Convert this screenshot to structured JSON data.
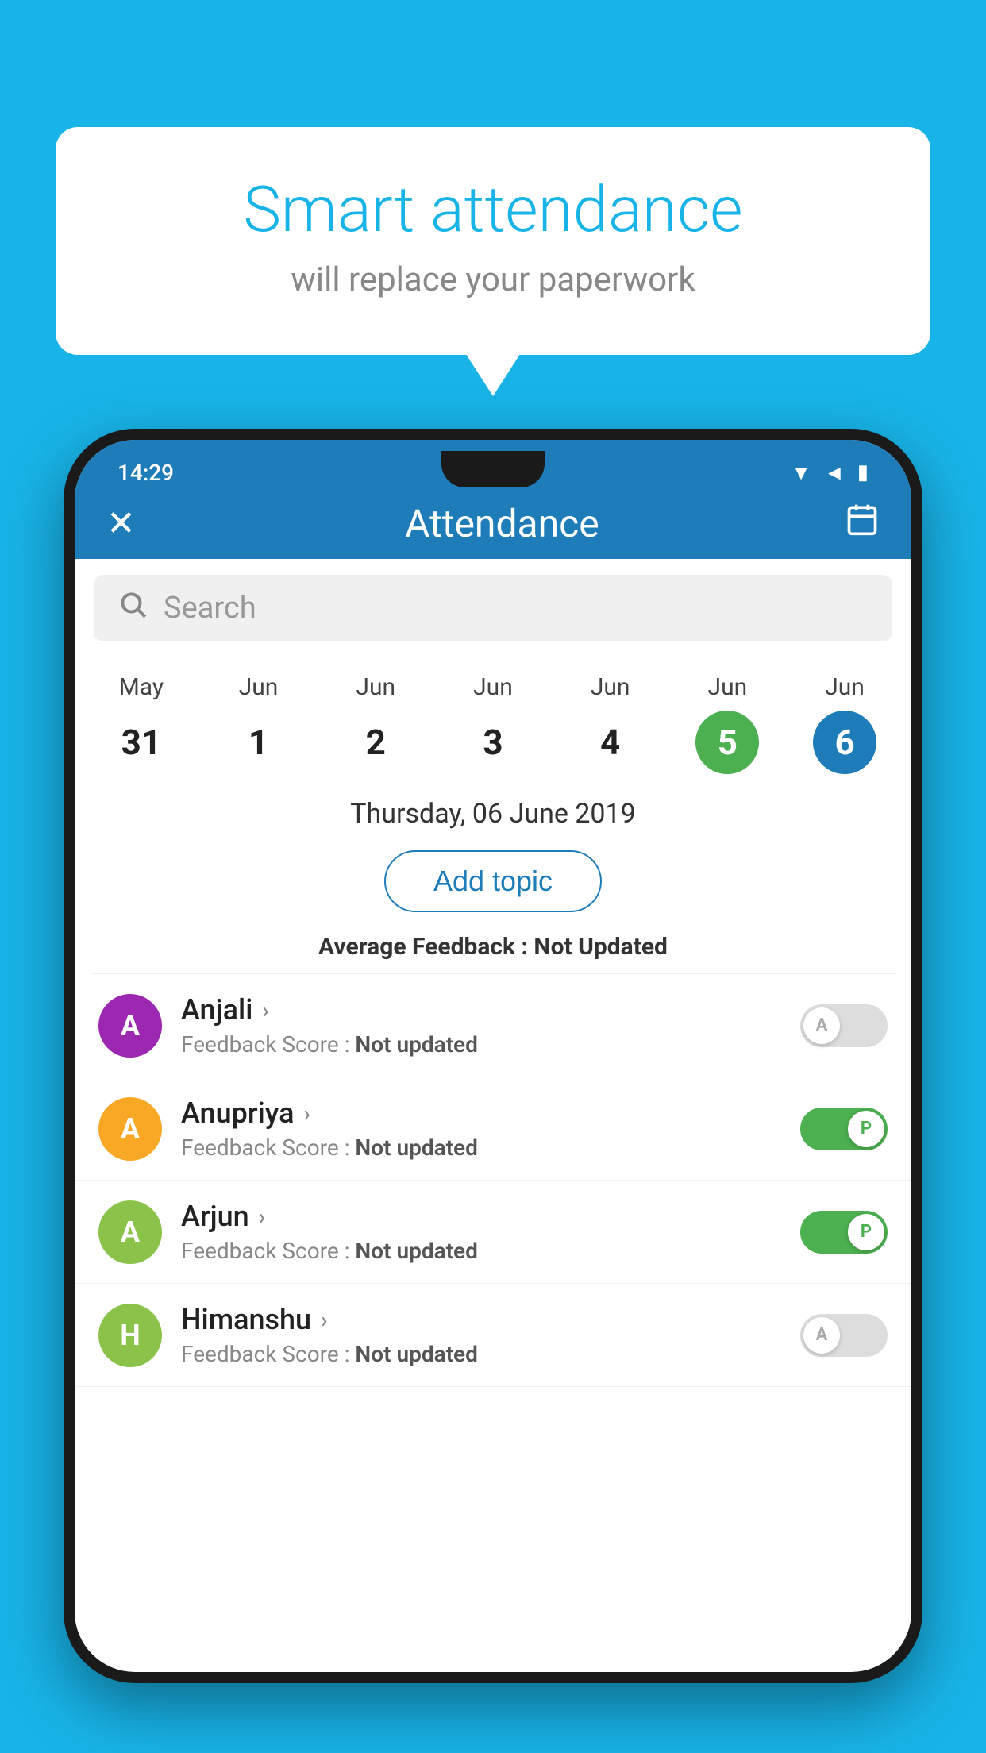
{
  "background_color": "#18b4e8",
  "bubble": {
    "title": "Smart attendance",
    "subtitle": "will replace your paperwork"
  },
  "status_bar": {
    "time": "14:29",
    "signal_icon": "▼◄",
    "battery_icon": "▮"
  },
  "app_header": {
    "close_label": "✕",
    "title": "Attendance",
    "calendar_icon": "📅"
  },
  "search": {
    "placeholder": "Search"
  },
  "calendar": {
    "dates": [
      {
        "month": "May",
        "day": "31",
        "style": "normal"
      },
      {
        "month": "Jun",
        "day": "1",
        "style": "normal"
      },
      {
        "month": "Jun",
        "day": "2",
        "style": "normal"
      },
      {
        "month": "Jun",
        "day": "3",
        "style": "normal"
      },
      {
        "month": "Jun",
        "day": "4",
        "style": "normal"
      },
      {
        "month": "Jun",
        "day": "5",
        "style": "today"
      },
      {
        "month": "Jun",
        "day": "6",
        "style": "selected"
      }
    ]
  },
  "selected_date_label": "Thursday, 06 June 2019",
  "add_topic_label": "Add topic",
  "avg_feedback_prefix": "Average Feedback : ",
  "avg_feedback_value": "Not Updated",
  "students": [
    {
      "name": "Anjali",
      "initial": "A",
      "avatar_color": "#9c27b0",
      "feedback_label": "Feedback Score : ",
      "feedback_value": "Not updated",
      "toggle_state": "off",
      "toggle_label": "A"
    },
    {
      "name": "Anupriya",
      "initial": "A",
      "avatar_color": "#f9a825",
      "feedback_label": "Feedback Score : ",
      "feedback_value": "Not updated",
      "toggle_state": "on",
      "toggle_label": "P"
    },
    {
      "name": "Arjun",
      "initial": "A",
      "avatar_color": "#8bc34a",
      "feedback_label": "Feedback Score : ",
      "feedback_value": "Not updated",
      "toggle_state": "on",
      "toggle_label": "P"
    },
    {
      "name": "Himanshu",
      "initial": "H",
      "avatar_color": "#8bc34a",
      "feedback_label": "Feedback Score : ",
      "feedback_value": "Not updated",
      "toggle_state": "off",
      "toggle_label": "A"
    }
  ]
}
